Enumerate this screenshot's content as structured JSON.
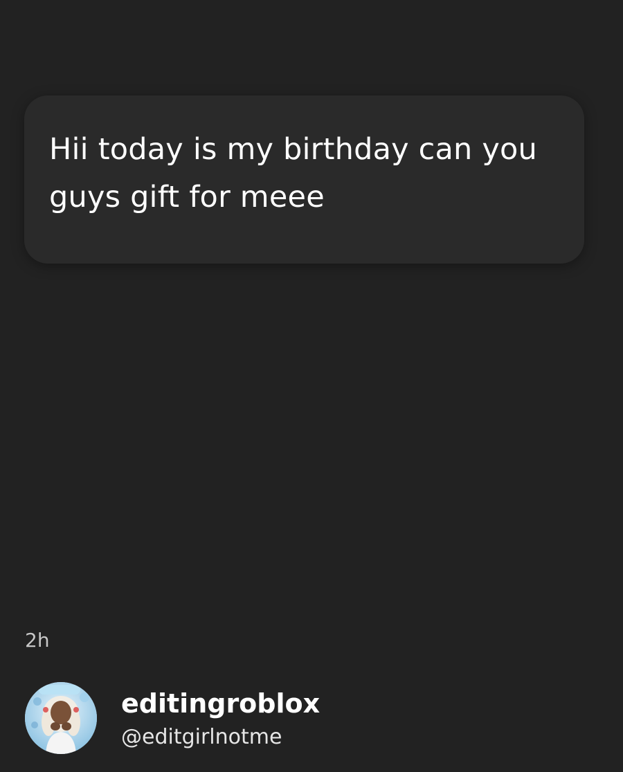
{
  "post": {
    "message": "Hii today is my birthday can you guys gift for meee",
    "timestamp": "2h"
  },
  "author": {
    "display_name": "editingroblox",
    "handle": "@editgirlnotme",
    "avatar_icon": "avatar-photo"
  },
  "colors": {
    "background": "#222222",
    "card": "#2a2a2a",
    "text": "#ffffff",
    "muted": "#c7c7c7"
  }
}
